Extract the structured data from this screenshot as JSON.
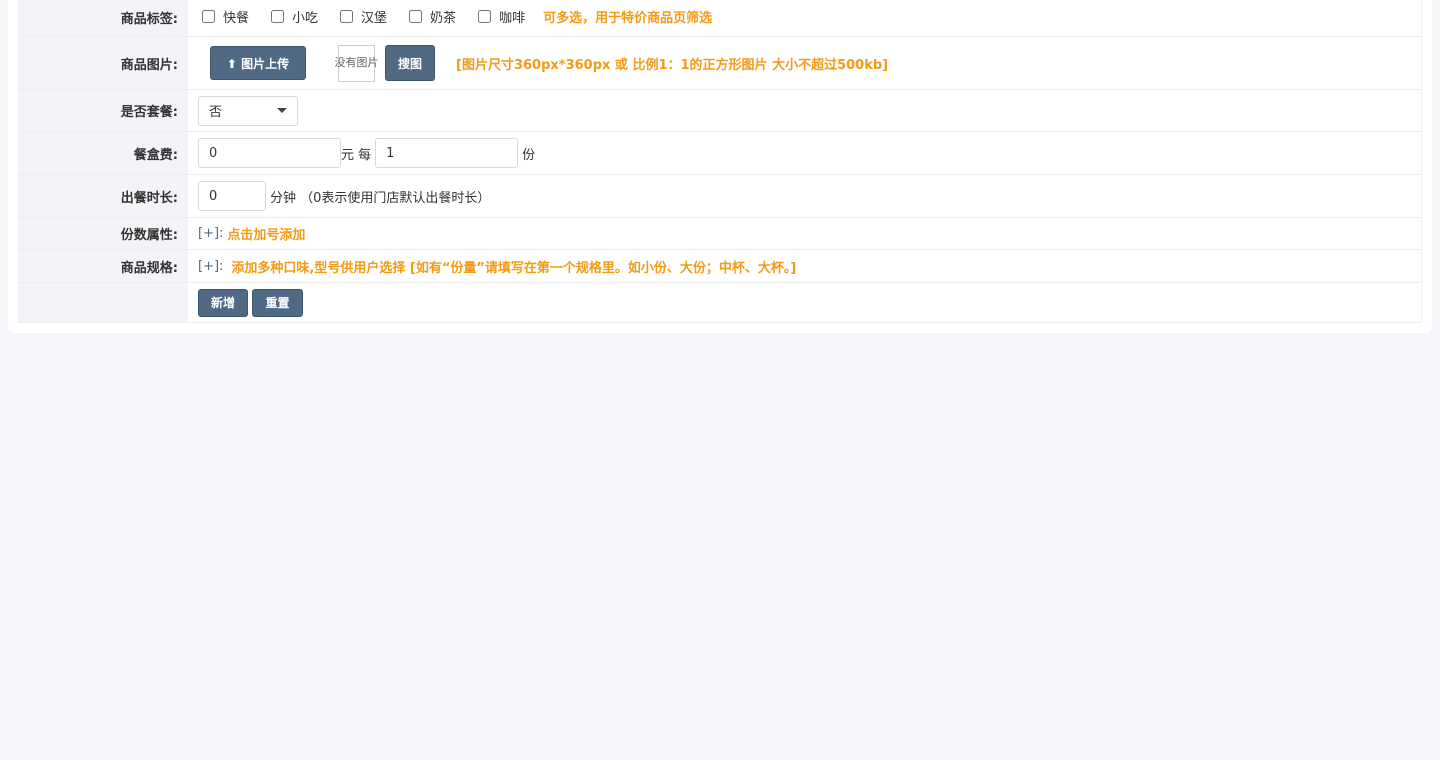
{
  "tags": {
    "label": "商品标签:",
    "options": [
      "快餐",
      "小吃",
      "汉堡",
      "奶茶",
      "咖啡"
    ],
    "hint": "可多选，用于特价商品页筛选"
  },
  "image": {
    "label": "商品图片:",
    "upload_label": "⬆ 图片上传",
    "no_image_text": "没有图片",
    "search_label": "搜图",
    "hint": "[图片尺寸360px*360px 或 比例1：1的正方形图片 大小不超过500kb]"
  },
  "combo": {
    "label": "是否套餐:",
    "selected": "否"
  },
  "boxfee": {
    "label": "餐盒费:",
    "value": "0",
    "unit_between": "元 每",
    "per_value": "1",
    "unit_after": "份"
  },
  "prep": {
    "label": "出餐时长:",
    "value": "0",
    "suffix": "分钟 （0表示使用门店默认出餐时长）"
  },
  "portion": {
    "label": "份数属性:",
    "plus": "[+]:",
    "hint": "点击加号添加"
  },
  "spec": {
    "label": "商品规格:",
    "plus": "[+]:",
    "hint": "添加多种口味,型号供用户选择 [如有“份量”请填写在第一个规格里。如小份、大份；中杯、大杯。]"
  },
  "actions": {
    "add_label": "新增",
    "reset_label": "重置"
  }
}
